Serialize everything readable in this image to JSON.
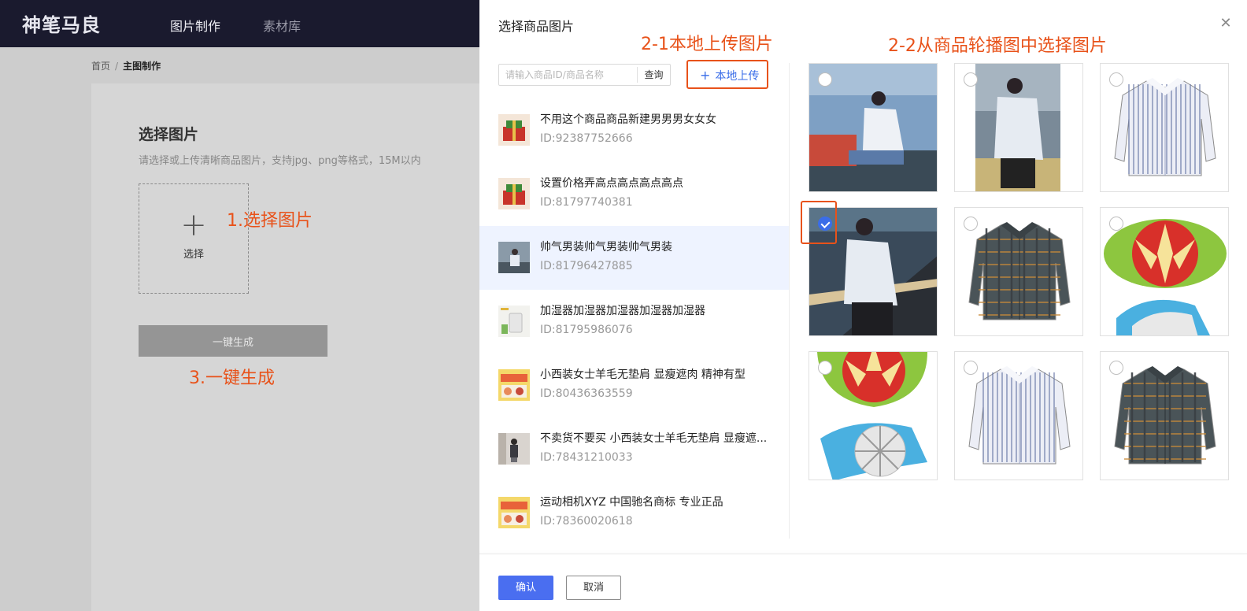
{
  "app": {
    "logo": "神笔马良",
    "nav": [
      "图片制作",
      "素材库"
    ]
  },
  "breadcrumb": {
    "home": "首页",
    "separator": "/",
    "current": "主图制作"
  },
  "main": {
    "section_title": "选择图片",
    "section_subtitle": "请选择或上传清晰商品图片，支持jpg、png等格式，15M以内",
    "upload_label": "选择",
    "generate_button": "一键生成"
  },
  "annotations": {
    "step1": "1.选择图片",
    "step2_1": "2-1本地上传图片",
    "step2_2": "2-2从商品轮播图中选择图片",
    "step3": "3.一键生成",
    "color": "#e8521a"
  },
  "drawer": {
    "title": "选择商品图片",
    "close_icon": "close-icon",
    "search_placeholder": "请输入商品ID/商品名称",
    "search_button": "查询",
    "local_upload_label": "本地上传",
    "confirm": "确认",
    "cancel": "取消",
    "accent": "#3a6de8"
  },
  "products": [
    {
      "name": "不用这个商品商品新建男男男女女女",
      "id": "ID:92387752666",
      "thumb": "gift",
      "selected": false
    },
    {
      "name": "设置价格弄高点高点高点高点",
      "id": "ID:81797740381",
      "thumb": "gift",
      "selected": false
    },
    {
      "name": "帅气男装帅气男装帅气男装",
      "id": "ID:81796427885",
      "thumb": "man",
      "selected": true
    },
    {
      "name": "加湿器加湿器加湿器加湿器加湿器",
      "id": "ID:81795986076",
      "thumb": "humidifier",
      "selected": false
    },
    {
      "name": "小西装女士羊毛无垫肩 显瘦遮肉 精神有型",
      "id": "ID:80436363559",
      "thumb": "poster",
      "selected": false
    },
    {
      "name": "不卖货不要买 小西装女士羊毛无垫肩 显瘦遮...",
      "id": "ID:78431210033",
      "thumb": "woman",
      "selected": false
    },
    {
      "name": "运动相机XYZ 中国驰名商标 专业正品",
      "id": "ID:78360020618",
      "thumb": "poster",
      "selected": false
    }
  ],
  "gallery": [
    {
      "type": "photo-dock",
      "checked": false
    },
    {
      "type": "photo-man",
      "checked": false
    },
    {
      "type": "shirt-stripe",
      "checked": false
    },
    {
      "type": "photo-road",
      "checked": true
    },
    {
      "type": "shirt-plaid",
      "checked": false
    },
    {
      "type": "apple-slicer",
      "checked": false
    },
    {
      "type": "apple-slicer-2",
      "checked": false
    },
    {
      "type": "shirt-stripe",
      "checked": false
    },
    {
      "type": "shirt-plaid",
      "checked": false
    }
  ]
}
